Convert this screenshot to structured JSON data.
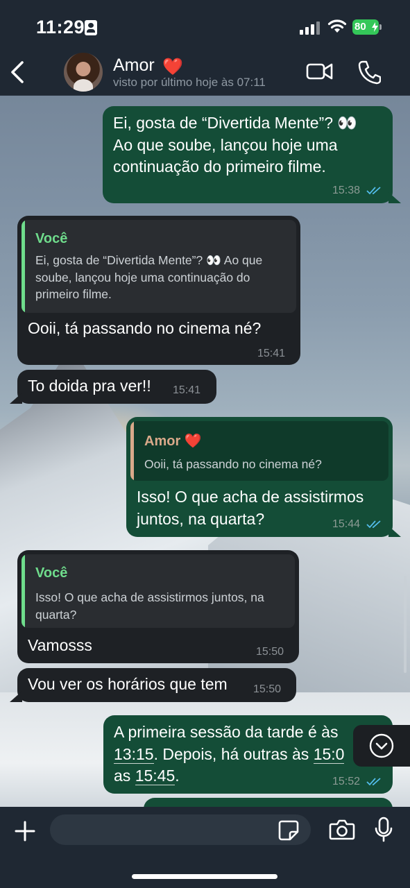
{
  "status_bar": {
    "time": "11:29",
    "battery": "80"
  },
  "header": {
    "contact_name": "Amor",
    "contact_emoji": "❤️",
    "last_seen": "visto por último hoje às 07:11",
    "icons": [
      "chevron-left-icon",
      "video-call-icon",
      "phone-call-icon"
    ]
  },
  "messages": [
    {
      "dir": "out",
      "lines": [
        "Ei, gosta de “Divertida Mente”? 👀",
        "Ao que soube, lançou hoje uma",
        "continuação do primeiro filme."
      ],
      "time": "15:38",
      "read": true
    },
    {
      "dir": "in",
      "quote": {
        "author": "Você",
        "lines": [
          "Ei, gosta de “Divertida Mente”? 👀 Ao que",
          "soube, lançou hoje uma continuação do",
          "primeiro filme."
        ]
      },
      "lines": [
        "Ooii, tá passando no cinema né?"
      ],
      "time": "15:41"
    },
    {
      "dir": "in",
      "lines": [
        "To doida pra ver!!"
      ],
      "time": "15:41"
    },
    {
      "dir": "out",
      "quote": {
        "author": "Amor ❤️",
        "lines": [
          "Ooii, tá passando no cinema né?"
        ]
      },
      "lines": [
        "Isso! O que acha de assistirmos",
        "juntos, na quarta?"
      ],
      "time": "15:44",
      "read": true
    },
    {
      "dir": "in",
      "quote": {
        "author": "Você",
        "lines": [
          "Isso! O que acha de assistirmos juntos, na",
          "quarta?"
        ]
      },
      "lines": [
        "Vamosss"
      ],
      "time": "15:50"
    },
    {
      "dir": "in",
      "lines": [
        "Vou ver os horários que tem"
      ],
      "time": "15:50"
    },
    {
      "dir": "out",
      "line1": "A primeira sessão da tarde é às",
      "line2_time": "13:15",
      "line2_text": ". Depois, há outras às ",
      "line2_time2": "15:0",
      "line3_prefix": "as ",
      "line3_time": "15:45",
      "line3_suffix": ".",
      "time": "15:52",
      "read": true
    }
  ],
  "colors": {
    "outgoing_bubble": "#144d37",
    "incoming_bubble": "#1e2125",
    "quote_author_you": "#6fdc8c",
    "quote_author_contact": "#d9a98a",
    "read_ticks": "#53bdeb"
  },
  "input": {
    "placeholder": "",
    "icons": [
      "plus-icon",
      "sticker-icon",
      "camera-icon",
      "microphone-icon"
    ]
  }
}
